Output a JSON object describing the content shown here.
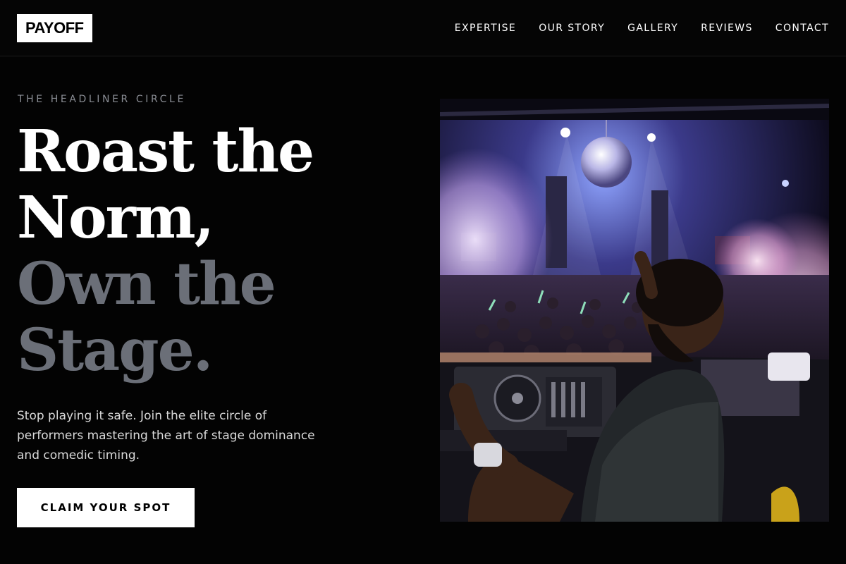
{
  "header": {
    "logo": "PAYOFF",
    "nav": [
      {
        "label": "EXPERTISE"
      },
      {
        "label": "OUR STORY"
      },
      {
        "label": "GALLERY"
      },
      {
        "label": "REVIEWS"
      },
      {
        "label": "CONTACT"
      }
    ]
  },
  "hero": {
    "eyebrow": "THE HEADLINER CIRCLE",
    "headline": {
      "line1": "Roast the",
      "line2": "Norm,",
      "line3": "Own the",
      "line4": "Stage."
    },
    "subtext": "Stop playing it safe. Join the elite circle of performers mastering the art of stage dominance and comedic timing.",
    "cta_label": "CLAIM YOUR SPOT"
  },
  "colors": {
    "background": "#030303",
    "text_primary": "#ffffff",
    "text_dim": "#6b6f78",
    "eyebrow": "#8a8d94"
  }
}
